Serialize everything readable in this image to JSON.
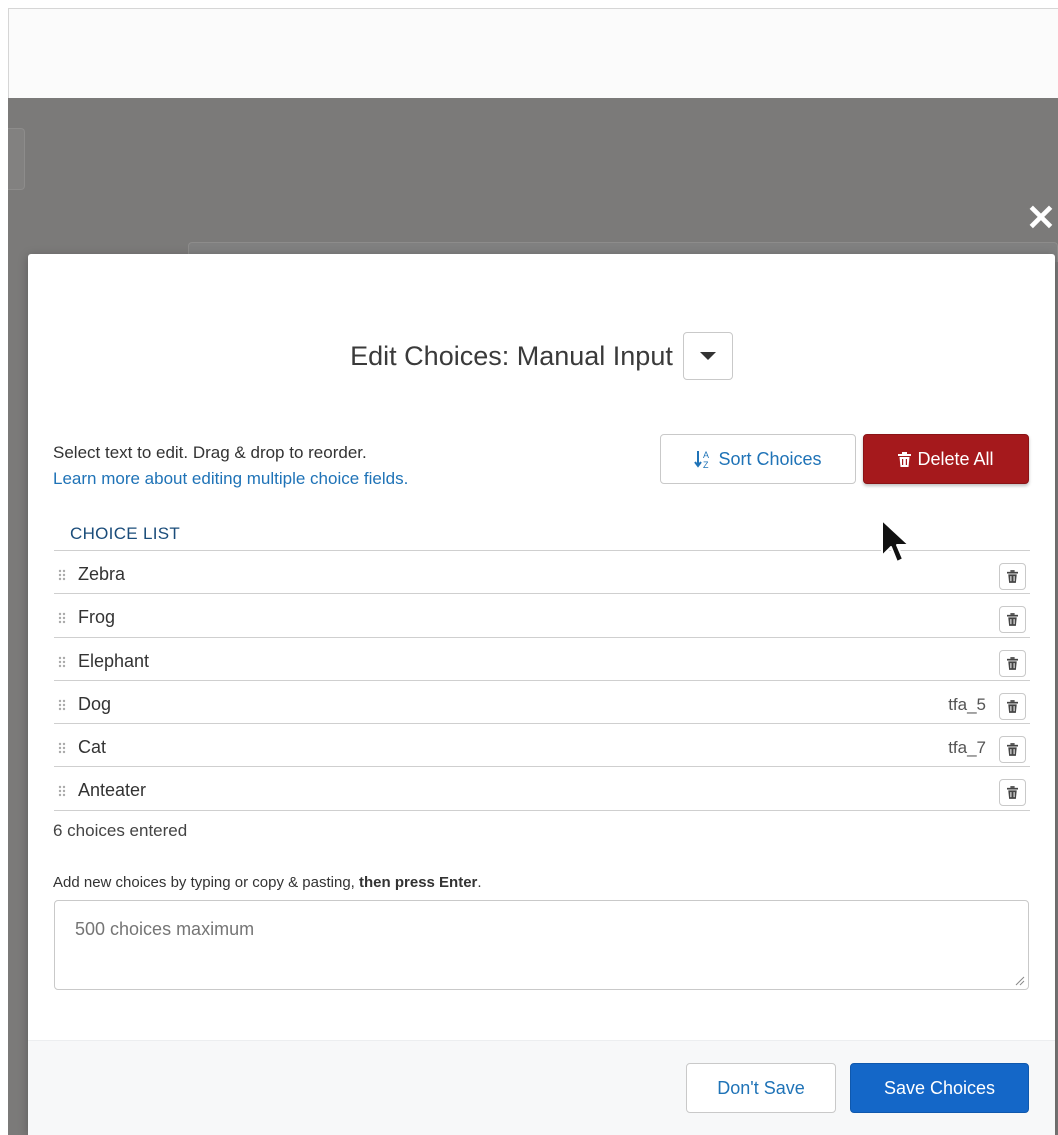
{
  "modal": {
    "title": "Edit Choices: Manual Input",
    "close_icon": "close-icon"
  },
  "help": {
    "text": "Select text to edit. Drag & drop to reorder.",
    "link": "Learn more about editing multiple choice fields."
  },
  "toolbar": {
    "sort_label": "Sort Choices",
    "delete_all_label": "Delete All"
  },
  "choice_list": {
    "header": "CHOICE LIST",
    "items": [
      {
        "label": "Zebra",
        "id": ""
      },
      {
        "label": "Frog",
        "id": ""
      },
      {
        "label": "Elephant",
        "id": ""
      },
      {
        "label": "Dog",
        "id": "tfa_5"
      },
      {
        "label": "Cat",
        "id": "tfa_7"
      },
      {
        "label": "Anteater",
        "id": ""
      }
    ],
    "count_text": "6 choices entered"
  },
  "add_choices": {
    "help_prefix": "Add new choices by typing or copy & pasting, ",
    "help_bold": "then press Enter",
    "help_suffix": ".",
    "placeholder": "500 choices maximum"
  },
  "footer": {
    "dont_save_label": "Don't Save",
    "save_label": "Save Choices"
  },
  "colors": {
    "primary": "#1467c8",
    "danger": "#a5191c",
    "link": "#1f73b7",
    "overlay": "#7b7a79"
  }
}
